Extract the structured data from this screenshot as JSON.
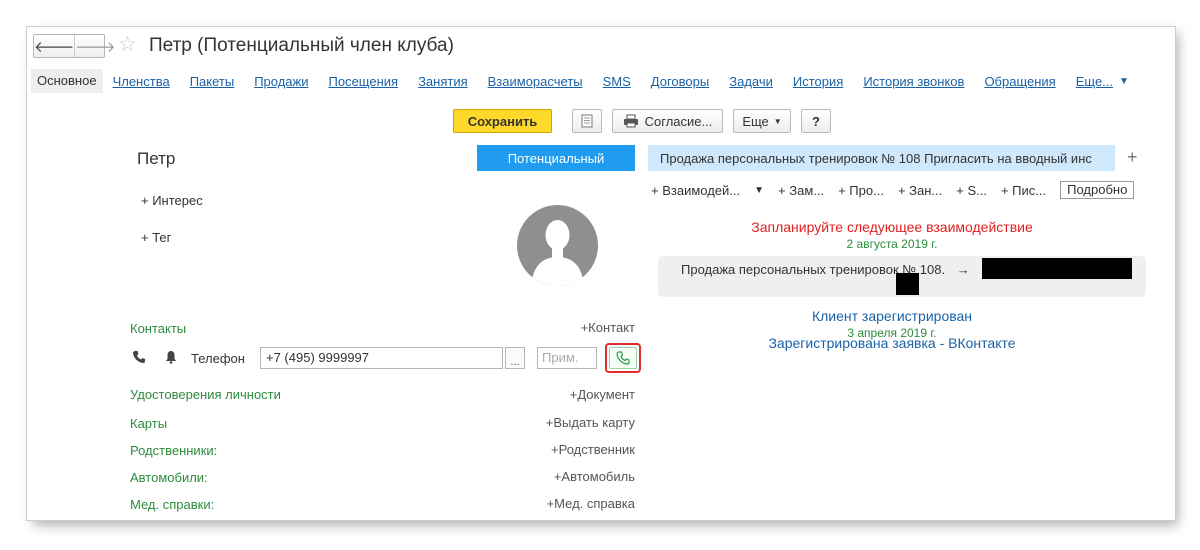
{
  "window": {
    "title": "Петр (Потенциальный член клуба)",
    "back": "🡐",
    "forward": "🡒"
  },
  "tabs": {
    "active": "Основное",
    "items": [
      "Членства",
      "Пакеты",
      "Продажи",
      "Посещения",
      "Занятия",
      "Взаиморасчеты",
      "SMS",
      "Договоры",
      "Задачи",
      "История",
      "История звонков",
      "Обращения"
    ],
    "more": "Еще..."
  },
  "toolbar": {
    "save": "Сохранить",
    "agreement": "Согласие...",
    "more": "Еще",
    "help": "?"
  },
  "client": {
    "name": "Петр",
    "add_interest": "+ Интерес",
    "add_tag": "+ Тег"
  },
  "contacts": {
    "title": "Контакты",
    "add": "+Контакт",
    "phone_label": "Телефон",
    "phone_value": "+7 (495) 9999997",
    "dots": "...",
    "note_placeholder": "Прим."
  },
  "sections": [
    {
      "label": "Удостоверения личности",
      "action": "+Документ"
    },
    {
      "label": "Карты",
      "action": "+Выдать карту"
    },
    {
      "label": "Родственники:",
      "action": "+Родственник"
    },
    {
      "label": "Автомобили:",
      "action": "+Автомобиль"
    },
    {
      "label": "Мед. справки:",
      "action": "+Мед. справка"
    }
  ],
  "status": {
    "button": "Потенциальный",
    "deal_tab": "Продажа персональных тренировок № 108  Пригласить на вводный инс",
    "add_tab": "+"
  },
  "actions": {
    "items": [
      "+ Взаимодей...",
      "+ Зам...",
      "+ Про...",
      "+ Зан...",
      "+ S...",
      "+ Пис..."
    ],
    "detail": "Подробно"
  },
  "timeline": {
    "plan_title": "Запланируйте следующее взаимодействие",
    "plan_date": "2 августа 2019 г.",
    "card_text": "Продажа персональных тренировок № 108.",
    "card_arrow": "→",
    "client_registered": "Клиент зарегистрирован",
    "registered_date": "3 апреля 2019 г.",
    "vk_request": "Зарегистрирована заявка - ВКонтакте"
  },
  "colors": {
    "save_button": "#ffd92a",
    "status_button": "#1f9cf0",
    "section_green": "#2e8b3e",
    "link_blue": "#1a62a8",
    "plan_red": "#e02020",
    "call_highlight": "#e02c2c"
  },
  "icons": {
    "star": "star-icon",
    "phone": "phone-icon",
    "bell": "bell-icon",
    "call": "call-icon",
    "document": "document-icon",
    "print": "printer-icon"
  }
}
